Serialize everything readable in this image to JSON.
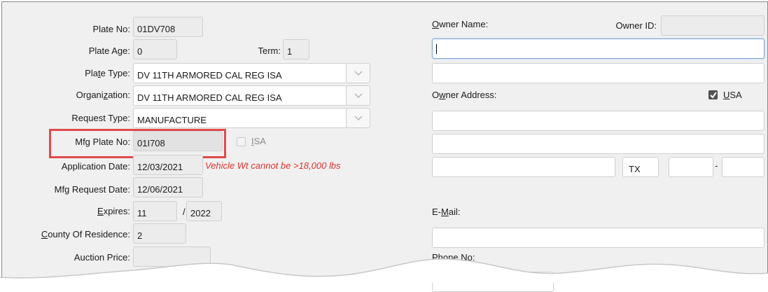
{
  "left": {
    "plate_no": {
      "label": "Plate No:",
      "value": "01DV708"
    },
    "plate_age": {
      "label": "Plate Age:",
      "value": "0"
    },
    "term": {
      "label": "Term:",
      "value": "1"
    },
    "plate_type": {
      "label_pre": "Pla",
      "label_u": "t",
      "label_post": "e Type:",
      "value": "DV 11TH ARMORED CAL REG ISA"
    },
    "organization": {
      "label_pre": "Organi",
      "label_u": "z",
      "label_post": "ation:",
      "value": "DV 11TH ARMORED CAL REG ISA"
    },
    "request_type": {
      "label": "Request Type:",
      "value": "MANUFACTURE"
    },
    "mfg_plate_no": {
      "label": "Mfg Plate No:",
      "value": "01I708"
    },
    "isa": {
      "label_u": "I",
      "label_post": "SA",
      "checked": false
    },
    "application_date": {
      "label": "Application Date:",
      "value": "12/03/2021"
    },
    "error_message": "Vehicle Wt cannot be >18,000 lbs",
    "mfg_request_date": {
      "label": "Mfg Request Date:",
      "value": "12/06/2021"
    },
    "expires": {
      "label_u": "E",
      "label_post": "xpires:",
      "month": "11",
      "separator": "/",
      "year": "2022"
    },
    "county": {
      "label_u": "C",
      "label_post": "ounty Of Residence:",
      "value": "2"
    },
    "auction_price": {
      "label": "Auction Price:",
      "value": ""
    }
  },
  "right": {
    "owner_name": {
      "label_u": "O",
      "label_post": "wner Name:",
      "line1": "",
      "line2": ""
    },
    "owner_id": {
      "label": "Owner ID:",
      "value": ""
    },
    "owner_address": {
      "label_pre": "O",
      "label_u": "w",
      "label_post": "ner Address:",
      "line1": "",
      "line2": "",
      "city": "",
      "state": "TX",
      "zip": "",
      "zip_sep": "-",
      "zip_ext": ""
    },
    "usa": {
      "label_u": "U",
      "label_post": "SA",
      "checked": true
    },
    "email": {
      "label_pre": "E-",
      "label_u": "M",
      "label_post": "ail:",
      "value": ""
    },
    "phone": {
      "label": "Phone No:",
      "value": ""
    }
  },
  "colors": {
    "highlight": "#e04a4a",
    "error": "#e0322e",
    "focus": "#7aa6d6"
  },
  "icons": [
    "chevron-down-icon",
    "checkmark-icon"
  ]
}
